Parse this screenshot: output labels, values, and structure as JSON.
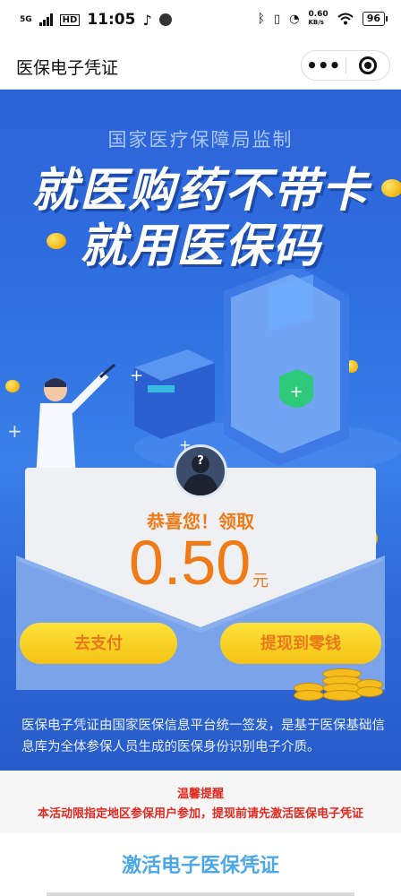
{
  "status_bar": {
    "network": "5G",
    "hd_badge": "HD",
    "time": "11:05",
    "net_speed_value": "0.60",
    "net_speed_unit": "KB/s",
    "battery": "96",
    "icons": [
      "signal-icon",
      "hd-icon",
      "music-icon",
      "app-icon",
      "bluetooth-icon",
      "vibrate-icon",
      "alarm-icon",
      "wifi-icon",
      "battery-icon"
    ]
  },
  "title_bar": {
    "title": "医保电子凭证",
    "more_label": "•••",
    "icons": [
      "more-icon",
      "close-mini-program-icon"
    ]
  },
  "hero": {
    "subtitle": "国家医疗保障局监制",
    "headline_line1": "就医购药不带卡",
    "headline_line2": "就用医保码"
  },
  "reward": {
    "congrats": "恭喜您！领取",
    "amount": "0.50",
    "unit": "元",
    "avatar_icon": "question-avatar-icon"
  },
  "buttons": {
    "pay": "去支付",
    "withdraw": "提现到零钱"
  },
  "description": "医保电子凭证由国家医保信息平台统一签发，是基于医保基础信息库为全体参保人员生成的医保身份识别电子介质。",
  "notice": {
    "title": "温馨提醒",
    "text": "本活动限指定地区参保用户参加，提现前请先激活医保电子凭证"
  },
  "activate": {
    "label": "激活电子医保凭证"
  },
  "colors": {
    "hero_blue": "#2f6fe0",
    "accent_orange": "#ef7a16",
    "button_yellow": "#f5c214",
    "notice_red": "#e4281e",
    "activate_blue": "#4aa7e8"
  }
}
